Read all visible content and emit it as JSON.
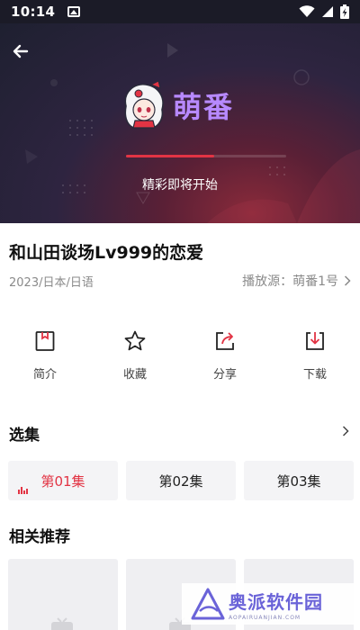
{
  "status_bar": {
    "time": "10:14"
  },
  "player": {
    "logo_text": "萌番",
    "message": "精彩即将开始",
    "progress": 0.55
  },
  "video": {
    "title": "和山田谈场Lv999的恋爱",
    "meta": "2023/日本/日语",
    "source_label": "播放源：萌番1号"
  },
  "actions": [
    {
      "label": "简介",
      "icon": "intro-bookmark-icon"
    },
    {
      "label": "收藏",
      "icon": "star-icon"
    },
    {
      "label": "分享",
      "icon": "share-icon"
    },
    {
      "label": "下载",
      "icon": "download-icon"
    }
  ],
  "episodes_section": {
    "title": "选集",
    "items": [
      {
        "label": "第01集",
        "active": true
      },
      {
        "label": "第02集",
        "active": false
      },
      {
        "label": "第03集",
        "active": false
      }
    ]
  },
  "recommend_section": {
    "title": "相关推荐"
  },
  "watermark": {
    "main": "奥派软件园",
    "sub": "AOPAIRUANJIAN.COM"
  },
  "colors": {
    "accent": "#e23444",
    "logo": "#b789ff",
    "hero_dark": "#1e2030"
  }
}
